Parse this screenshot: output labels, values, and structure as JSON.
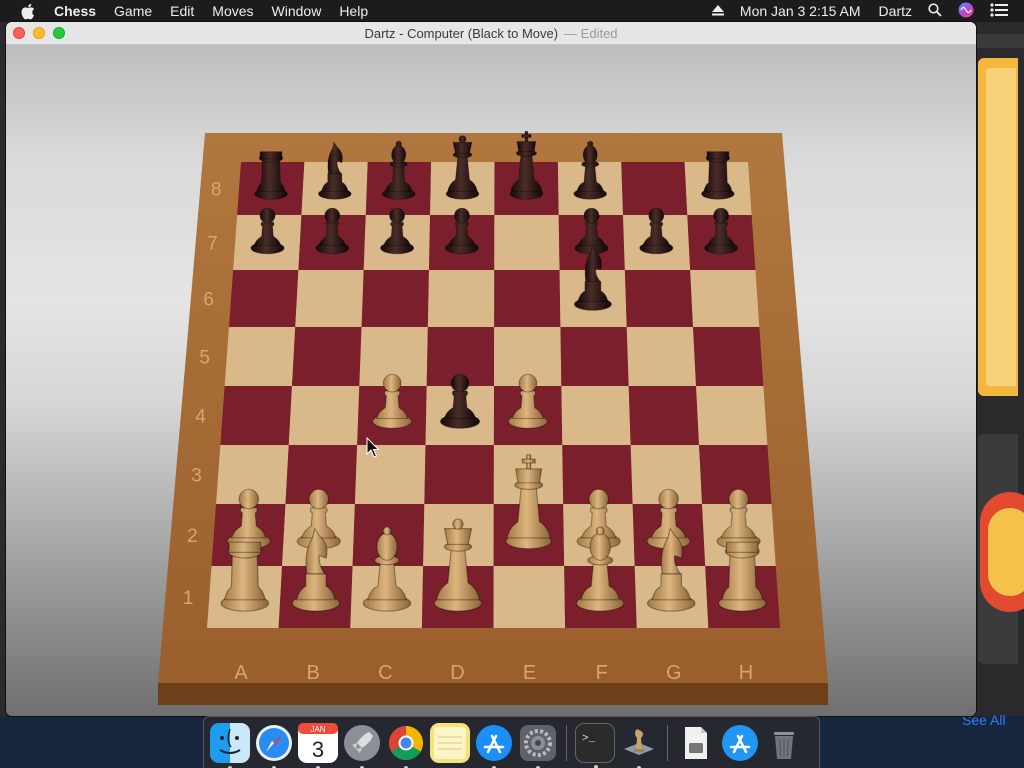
{
  "menubar": {
    "apple_icon": "apple-icon",
    "items": [
      "Chess",
      "Game",
      "Edit",
      "Moves",
      "Window",
      "Help"
    ],
    "clock": "Mon Jan 3  2:15 AM",
    "user": "Dartz",
    "icons": [
      "eject-icon",
      "search-icon",
      "siri-icon",
      "control-center-icon"
    ]
  },
  "window": {
    "title": "Dartz - Computer   (Black to Move)",
    "edited": "— Edited"
  },
  "board": {
    "files": [
      "A",
      "B",
      "C",
      "D",
      "E",
      "F",
      "G",
      "H"
    ],
    "ranks": [
      "1",
      "2",
      "3",
      "4",
      "5",
      "6",
      "7",
      "8"
    ],
    "pieces": [
      {
        "sq": "a8",
        "color": "black",
        "type": "rook"
      },
      {
        "sq": "b8",
        "color": "black",
        "type": "knight"
      },
      {
        "sq": "c8",
        "color": "black",
        "type": "bishop"
      },
      {
        "sq": "d8",
        "color": "black",
        "type": "queen"
      },
      {
        "sq": "e8",
        "color": "black",
        "type": "king"
      },
      {
        "sq": "f8",
        "color": "black",
        "type": "bishop"
      },
      {
        "sq": "h8",
        "color": "black",
        "type": "rook"
      },
      {
        "sq": "a7",
        "color": "black",
        "type": "pawn"
      },
      {
        "sq": "b7",
        "color": "black",
        "type": "pawn"
      },
      {
        "sq": "c7",
        "color": "black",
        "type": "pawn"
      },
      {
        "sq": "d7",
        "color": "black",
        "type": "pawn"
      },
      {
        "sq": "f7",
        "color": "black",
        "type": "pawn"
      },
      {
        "sq": "g7",
        "color": "black",
        "type": "pawn"
      },
      {
        "sq": "h7",
        "color": "black",
        "type": "pawn"
      },
      {
        "sq": "f6",
        "color": "black",
        "type": "knight"
      },
      {
        "sq": "d4",
        "color": "black",
        "type": "pawn"
      },
      {
        "sq": "c4",
        "color": "white",
        "type": "pawn"
      },
      {
        "sq": "e4",
        "color": "white",
        "type": "pawn"
      },
      {
        "sq": "e2",
        "color": "white",
        "type": "king"
      },
      {
        "sq": "a2",
        "color": "white",
        "type": "pawn"
      },
      {
        "sq": "b2",
        "color": "white",
        "type": "pawn"
      },
      {
        "sq": "f2",
        "color": "white",
        "type": "pawn"
      },
      {
        "sq": "g2",
        "color": "white",
        "type": "pawn"
      },
      {
        "sq": "h2",
        "color": "white",
        "type": "pawn"
      },
      {
        "sq": "a1",
        "color": "white",
        "type": "rook"
      },
      {
        "sq": "b1",
        "color": "white",
        "type": "knight"
      },
      {
        "sq": "c1",
        "color": "white",
        "type": "bishop"
      },
      {
        "sq": "d1",
        "color": "white",
        "type": "queen"
      },
      {
        "sq": "f1",
        "color": "white",
        "type": "bishop"
      },
      {
        "sq": "g1",
        "color": "white",
        "type": "knight"
      },
      {
        "sq": "h1",
        "color": "white",
        "type": "rook"
      }
    ]
  },
  "colors": {
    "light_square": "#d9b98a",
    "dark_square": "#7a1f2b",
    "frame": "#a86a36",
    "white_piece": "#c9a06a",
    "black_piece": "#2a1614"
  },
  "dock": {
    "calendar_month": "JAN",
    "calendar_day": "3",
    "apps": [
      "finder",
      "safari",
      "calendar",
      "launchpad",
      "chrome",
      "notes",
      "app-store",
      "system-preferences",
      "terminal",
      "chess",
      "documents",
      "app-store-2",
      "trash"
    ]
  },
  "see_all": "See All"
}
